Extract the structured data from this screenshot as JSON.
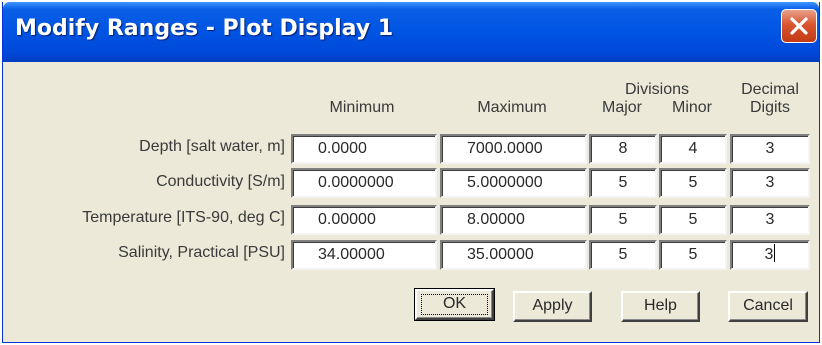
{
  "window": {
    "title": "Modify Ranges - Plot Display 1"
  },
  "headers": {
    "minimum": "Minimum",
    "maximum": "Maximum",
    "divisions": "Divisions",
    "major": "Major",
    "minor": "Minor",
    "decimal_line1": "Decimal",
    "decimal_line2": "Digits"
  },
  "rows": [
    {
      "label": "Depth [salt water, m]",
      "minimum": "0.0000",
      "maximum": "7000.0000",
      "major": "8",
      "minor": "4",
      "decimal": "3"
    },
    {
      "label": "Conductivity [S/m]",
      "minimum": "0.0000000",
      "maximum": "5.0000000",
      "major": "5",
      "minor": "5",
      "decimal": "3"
    },
    {
      "label": "Temperature [ITS-90, deg C]",
      "minimum": "0.00000",
      "maximum": "8.00000",
      "major": "5",
      "minor": "5",
      "decimal": "3"
    },
    {
      "label": "Salinity, Practical [PSU]",
      "minimum": "34.00000",
      "maximum": "35.00000",
      "major": "5",
      "minor": "5",
      "decimal": "3"
    }
  ],
  "buttons": {
    "ok": "OK",
    "apply": "Apply",
    "help": "Help",
    "cancel": "Cancel"
  },
  "icons": {
    "close": "close-icon"
  },
  "colors": {
    "titlebar": "#0054e3",
    "close_button": "#d8552f",
    "dialog_face": "#ece9d8"
  }
}
